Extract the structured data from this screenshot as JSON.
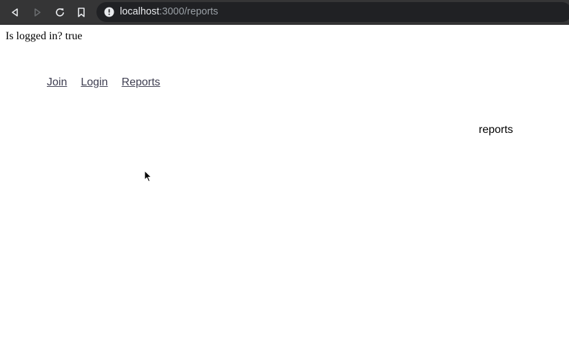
{
  "browser": {
    "url_host": "localhost",
    "url_path": ":3000/reports"
  },
  "page": {
    "status_text": "Is logged in? true",
    "nav_links": [
      {
        "label": "Join"
      },
      {
        "label": "Login"
      },
      {
        "label": "Reports"
      }
    ],
    "heading": "reports"
  },
  "icons": {
    "back": "back-arrow-icon",
    "forward": "forward-arrow-icon",
    "reload": "reload-icon",
    "bookmark": "bookmark-icon",
    "site_info": "info-icon",
    "pointer": "mouse-pointer-icon"
  },
  "colors": {
    "toolbar_bg": "#353536",
    "urlbar_bg": "#202124",
    "url_host": "#e8eaed",
    "url_path": "#9aa0a6",
    "link": "#3c3c4f"
  }
}
